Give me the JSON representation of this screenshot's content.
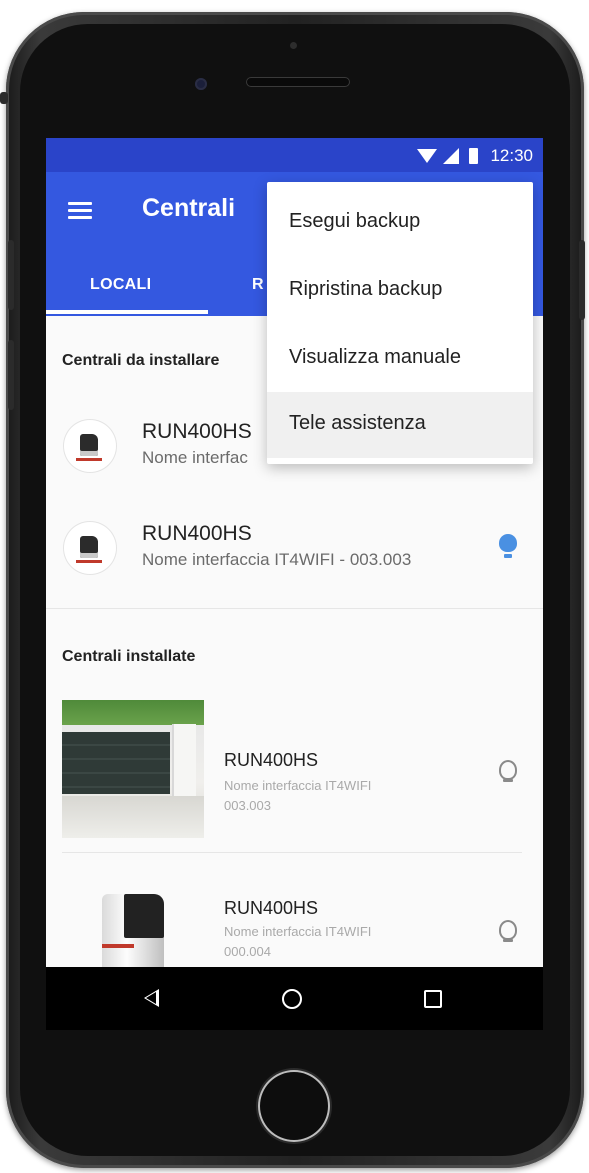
{
  "status_bar": {
    "time": "12:30"
  },
  "app_bar": {
    "title": "Centrali",
    "tabs": [
      {
        "label": "LOCALI"
      },
      {
        "label": "R"
      }
    ]
  },
  "sections": {
    "to_install": {
      "title": "Centrali da installare",
      "items": [
        {
          "name": "RUN400HS",
          "subtitle": "Nome interfac"
        },
        {
          "name": "RUN400HS",
          "subtitle": "Nome interfaccia IT4WIFI - 003.003"
        }
      ]
    },
    "installed": {
      "title": "Centrali installate",
      "items": [
        {
          "name": "RUN400HS",
          "subtitle_line1": "Nome interfaccia IT4WIFI",
          "subtitle_line2": "003.003"
        },
        {
          "name": "RUN400HS",
          "subtitle_line1": "Nome interfaccia IT4WIFI",
          "subtitle_line2": "000.004"
        }
      ]
    }
  },
  "menu": {
    "items": [
      {
        "label": "Esegui backup"
      },
      {
        "label": "Ripristina backup"
      },
      {
        "label": "Visualizza manuale"
      },
      {
        "label": "Tele assistenza"
      }
    ]
  },
  "colors": {
    "status_bar": "#2a44c9",
    "app_bar": "#3458e0",
    "bulb_active": "#4a90e2"
  },
  "icons": [
    "menu-icon",
    "wifi-icon",
    "signal-icon",
    "battery-icon",
    "bulb-icon",
    "back-icon",
    "home-icon",
    "recents-icon"
  ]
}
